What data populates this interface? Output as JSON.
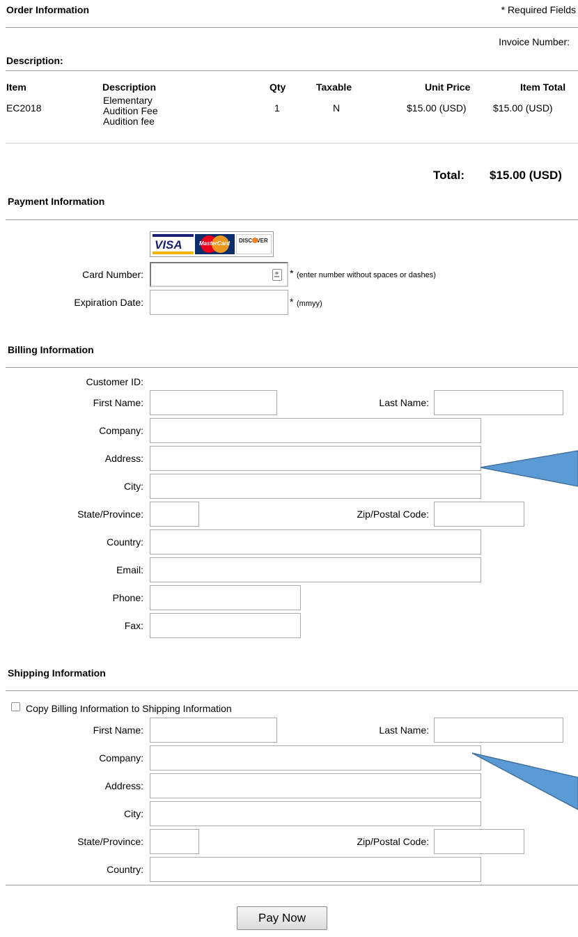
{
  "order": {
    "title": "Order Information",
    "required_note": "* Required Fields",
    "invoice_label": "Invoice Number:",
    "description_label": "Description:",
    "columns": [
      "Item",
      "Description",
      "Qty",
      "Taxable",
      "Unit Price",
      "Item Total"
    ],
    "rows": [
      {
        "item": "EC2018",
        "desc_line1": "Elementary",
        "desc_line2": "Audition Fee",
        "desc_line3": "Audition fee",
        "qty": "1",
        "taxable": "N",
        "unit_price": "$15.00 (USD)",
        "item_total": "$15.00 (USD)"
      }
    ],
    "total_label": "Total:",
    "total_value": "$15.00 (USD)"
  },
  "payment": {
    "title": "Payment Information",
    "cards": [
      "VISA",
      "MasterCard",
      "DISCOVER"
    ],
    "card_number_label": "Card Number:",
    "card_number_hint": "(enter number without spaces or dashes)",
    "expiration_label": "Expiration Date:",
    "expiration_hint": "(mmyy)",
    "asterisk": "*"
  },
  "billing": {
    "title": "Billing Information",
    "customer_id_label": "Customer ID:",
    "first_name_label": "First Name:",
    "last_name_label": "Last Name:",
    "company_label": "Company:",
    "address_label": "Address:",
    "city_label": "City:",
    "state_label": "State/Province:",
    "zip_label": "Zip/Postal Code:",
    "country_label": "Country:",
    "email_label": "Email:",
    "phone_label": "Phone:",
    "fax_label": "Fax:"
  },
  "shipping": {
    "title": "Shipping Information",
    "copy_label": "Copy Billing Information to Shipping Information",
    "first_name_label": "First Name:",
    "last_name_label": "Last Name:",
    "company_label": "Company:",
    "address_label": "Address:",
    "city_label": "City:",
    "state_label": "State/Province:",
    "zip_label": "Zip/Postal Code:",
    "country_label": "Country:"
  },
  "actions": {
    "pay_now": "Pay Now"
  },
  "colors": {
    "callout_fill": "#5b9bd5",
    "callout_stroke": "#41719c",
    "rule": "#9a9a9a"
  }
}
